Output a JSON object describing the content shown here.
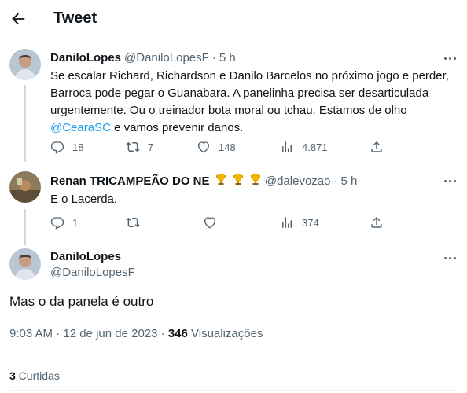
{
  "header": {
    "title": "Tweet"
  },
  "tweets": [
    {
      "name": "DaniloLopes",
      "handle": "@DaniloLopesF",
      "time": "5 h",
      "text_before": "Se escalar Richard, Richardson e Danilo Barcelos no próximo jogo e perder, Barroca pode pegar o Guanabara. A panelinha precisa ser desarticulada urgentemente. Ou o treinador bota moral ou tchau. Estamos de olho ",
      "mention": "@CearaSC",
      "text_after": " e vamos prevenir danos.",
      "replies": "18",
      "retweets": "7",
      "likes": "148",
      "views": "4.871"
    },
    {
      "name": "Renan TRICAMPEÃO DO NE",
      "handle": "@dalevozao",
      "time": "5 h",
      "text": "E o Lacerda.",
      "replies": "1",
      "retweets": "",
      "likes": "",
      "views": "374",
      "trophies": [
        "trophy-icon",
        "trophy-icon",
        "trophy-icon"
      ]
    }
  ],
  "main_tweet": {
    "name": "DaniloLopes",
    "handle": "@DaniloLopesF",
    "text": "Mas o da panela é outro",
    "time_date": "9:03 AM · 12 de jun de 2023 · ",
    "views_count": "346",
    "views_label": " Visualizações",
    "retweets_count": "3",
    "retweets_label": " Curtidas"
  },
  "colors": {
    "accent": "#1d9bf0",
    "secondary_text": "#536471",
    "thread_line": "#cfd9de"
  }
}
